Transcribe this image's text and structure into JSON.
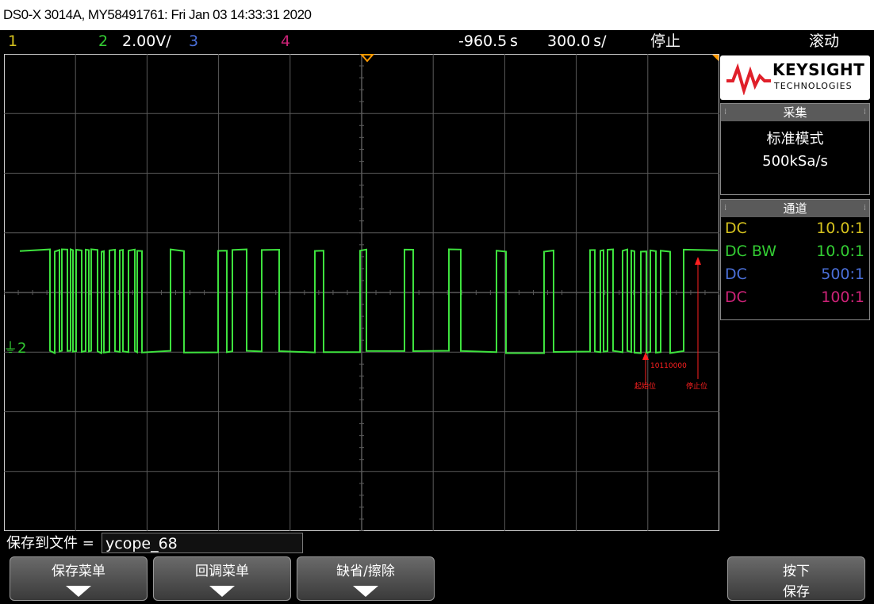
{
  "title": "DS0-X 3014A, MY58491761: Fri Jan 03 14:33:31 2020",
  "status": {
    "ch1": "1",
    "ch2": "2",
    "ch2_scale": "2.00V/",
    "ch3": "3",
    "ch4": "4",
    "time_offset": "-960.5&#x2009;s",
    "time_scale": "300.0&#x2009;s/",
    "run_state": "停止",
    "trigger_mode": "滚动"
  },
  "colors": {
    "ch1": "#d4c11e",
    "ch2": "#33cc33",
    "ch3": "#4a6fd8",
    "ch4": "#cc2277",
    "grid": "#5a5a5a",
    "trace": "#3ee23e",
    "annotation": "#ff2020"
  },
  "trace": {
    "ground_marker": "2",
    "high_level_label": "",
    "annotation_bits": "10110000",
    "annotation_start": "起始位",
    "annotation_stop": "停止位"
  },
  "panel": {
    "brand": "KEYSIGHT",
    "brand_sub": "TECHNOLOGIES",
    "acq_header": "采集",
    "acq_mode": "标准模式",
    "acq_rate": "500kSa/s",
    "ch_header": "通道",
    "channels": [
      {
        "coupling": "DC",
        "probe": "10.0:1",
        "color": "#d4c11e"
      },
      {
        "coupling": "DC BW",
        "probe": "10.0:1",
        "color": "#33cc33"
      },
      {
        "coupling": "DC",
        "probe": "500:1",
        "color": "#4a6fd8"
      },
      {
        "coupling": "DC",
        "probe": "100:1",
        "color": "#cc2277"
      }
    ]
  },
  "file": {
    "label": "保存到文件 =",
    "value": "ycope_68"
  },
  "softkeys": {
    "save_menu": "保存菜单",
    "recall_menu": "回调菜单",
    "default_erase": "缺省/擦除",
    "press_label": "按下",
    "save_label": "保存"
  },
  "icons": {
    "ground": "ground-icon",
    "trigger": "trigger-marker-icon",
    "arrow": "down-arrow-icon"
  }
}
